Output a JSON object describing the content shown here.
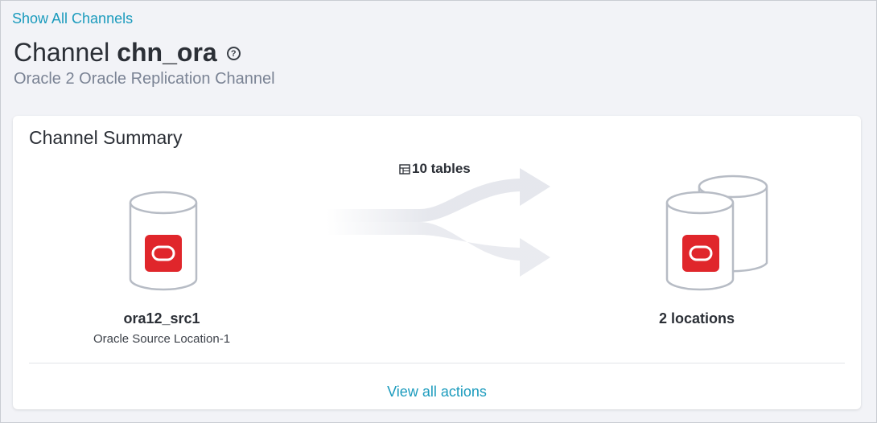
{
  "nav": {
    "back_label": "Show All Channels"
  },
  "header": {
    "title_prefix": "Channel",
    "channel_name": "chn_ora",
    "help_glyph": "?",
    "subtitle": "Oracle 2 Oracle Replication Channel"
  },
  "summary": {
    "title": "Channel Summary",
    "tables_label": "10 tables",
    "source": {
      "name": "ora12_src1",
      "description": "Oracle Source Location-1"
    },
    "target": {
      "label": "2 locations"
    },
    "actions_label": "View all actions"
  },
  "colors": {
    "link": "#1b9bbd",
    "oracle_red": "#e0262b",
    "db_outline": "#b7bcc5",
    "arrow": "#e4e6ec"
  },
  "icons": [
    "help-icon",
    "table-icon",
    "source-database-icon",
    "target-database-icon",
    "oracle-logo-icon",
    "flow-arrows"
  ]
}
